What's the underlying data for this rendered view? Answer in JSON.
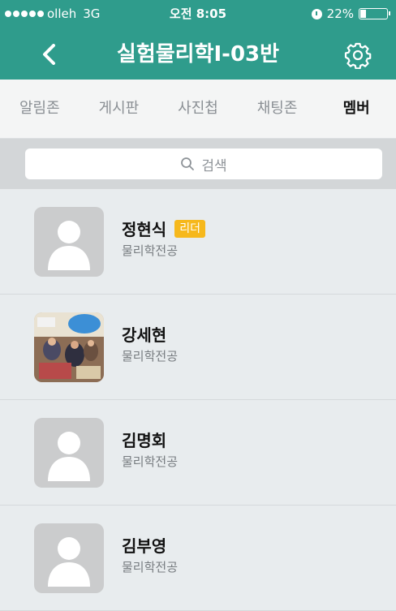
{
  "status_bar": {
    "carrier": "olleh",
    "network": "3G",
    "time": "오전 8:05",
    "battery": "22%",
    "battery_level": 0.22
  },
  "nav": {
    "title": "실험물리학I-03반",
    "back_icon": "chevron-left-icon",
    "settings_icon": "gear-icon"
  },
  "tabs": [
    {
      "label": "알림존",
      "active": false
    },
    {
      "label": "게시판",
      "active": false
    },
    {
      "label": "사진첩",
      "active": false
    },
    {
      "label": "채팅존",
      "active": false
    },
    {
      "label": "멤버",
      "active": true
    }
  ],
  "search": {
    "placeholder": "검색",
    "icon": "search-icon"
  },
  "members": [
    {
      "name": "정현식",
      "badge": "리더",
      "major": "물리학전공",
      "avatar": "default-person-icon"
    },
    {
      "name": "강세현",
      "major": "물리학전공",
      "avatar": "photo"
    },
    {
      "name": "김명회",
      "major": "물리학전공",
      "avatar": "default-person-icon"
    },
    {
      "name": "김부영",
      "major": "물리학전공",
      "avatar": "default-person-icon"
    }
  ],
  "colors": {
    "header": "#2f9c8c",
    "leader_badge": "#f6b81c",
    "active_tab": "#111111",
    "inactive_tab": "#8a8f94"
  }
}
